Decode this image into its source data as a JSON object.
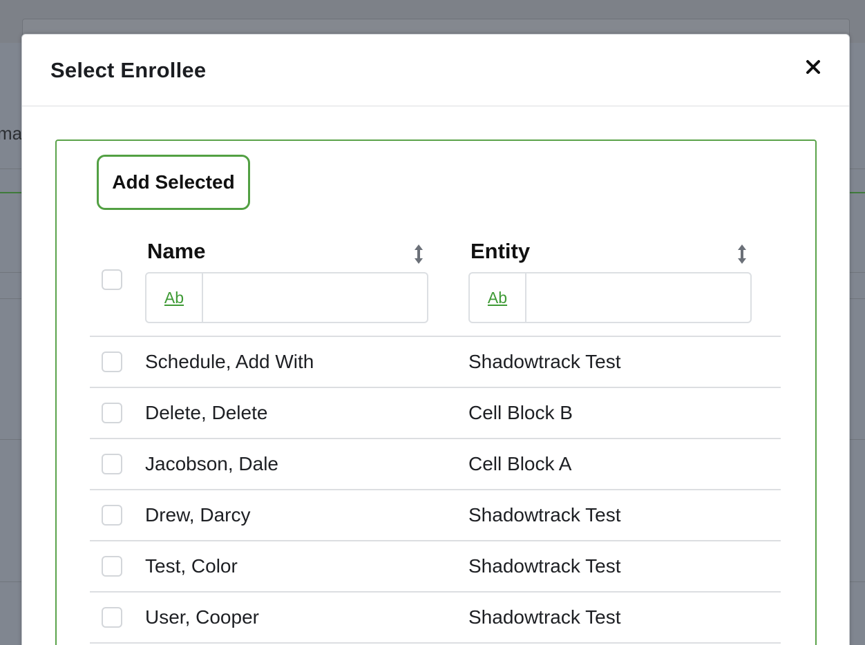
{
  "background": {
    "partial_text": "ma"
  },
  "modal": {
    "title": "Select Enrollee",
    "close_icon": "close-icon"
  },
  "toolbar": {
    "add_selected_label": "Add Selected"
  },
  "table": {
    "columns": [
      {
        "label": "Name",
        "filter_mode_label": "Ab",
        "filter_value": ""
      },
      {
        "label": "Entity",
        "filter_mode_label": "Ab",
        "filter_value": ""
      }
    ],
    "rows": [
      {
        "name": "Schedule, Add With",
        "entity": "Shadowtrack Test",
        "checked": false
      },
      {
        "name": "Delete, Delete",
        "entity": "Cell Block B",
        "checked": false
      },
      {
        "name": "Jacobson, Dale",
        "entity": "Cell Block A",
        "checked": false
      },
      {
        "name": "Drew, Darcy",
        "entity": "Shadowtrack Test",
        "checked": false
      },
      {
        "name": "Test, Color",
        "entity": "Shadowtrack Test",
        "checked": false
      },
      {
        "name": "User, Cooper",
        "entity": "Shadowtrack Test",
        "checked": false
      }
    ]
  },
  "colors": {
    "accent_green": "#52a043",
    "filter_link_green": "#3e9a35",
    "text_dark": "#1b1d21",
    "overlay": "#808690"
  }
}
